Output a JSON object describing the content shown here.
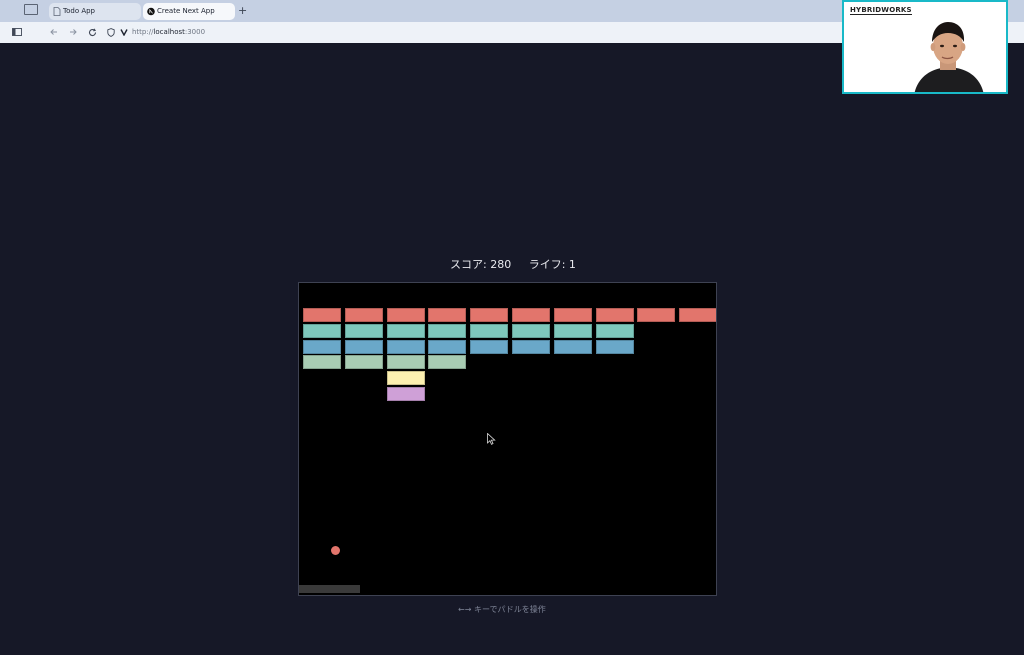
{
  "browser": {
    "tabs": [
      {
        "label": "Todo App",
        "active": false
      },
      {
        "label": "Create Next App",
        "active": true
      }
    ],
    "new_tab_symbol": "+",
    "url_prefix": "http://",
    "url_host": "localhost",
    "url_port": ":3000"
  },
  "game": {
    "score_text": "スコア: 280",
    "lives_text": "ライフ: 1",
    "hint": "←→ キーでパドルを操作",
    "colors": {
      "red": "#e2756c",
      "teal": "#7ec8bc",
      "blue": "#6aa8c9",
      "sage": "#a8ccb3",
      "yellow": "#fdf0b0",
      "lilac": "#cfa0d7",
      "ball": "#e2756c",
      "paddle": "#3a3a3a"
    },
    "bricks": [
      {
        "row": 0,
        "cols": [
          0,
          1,
          2,
          3,
          4,
          5,
          6,
          7,
          8,
          9
        ],
        "color": "red"
      },
      {
        "row": 1,
        "cols": [
          0,
          1,
          2,
          3,
          4,
          5,
          6,
          7
        ],
        "color": "teal"
      },
      {
        "row": 2,
        "cols": [
          0,
          1,
          2,
          3,
          4,
          5,
          6,
          7
        ],
        "color": "blue"
      },
      {
        "row": 3,
        "cols": [
          0,
          1,
          2,
          3
        ],
        "color": "sage"
      },
      {
        "row": 4,
        "cols": [
          2
        ],
        "color": "yellow"
      },
      {
        "row": 5,
        "cols": [
          2
        ],
        "color": "lilac"
      }
    ]
  },
  "webcam": {
    "logo": "HYBRIDWORKS"
  }
}
